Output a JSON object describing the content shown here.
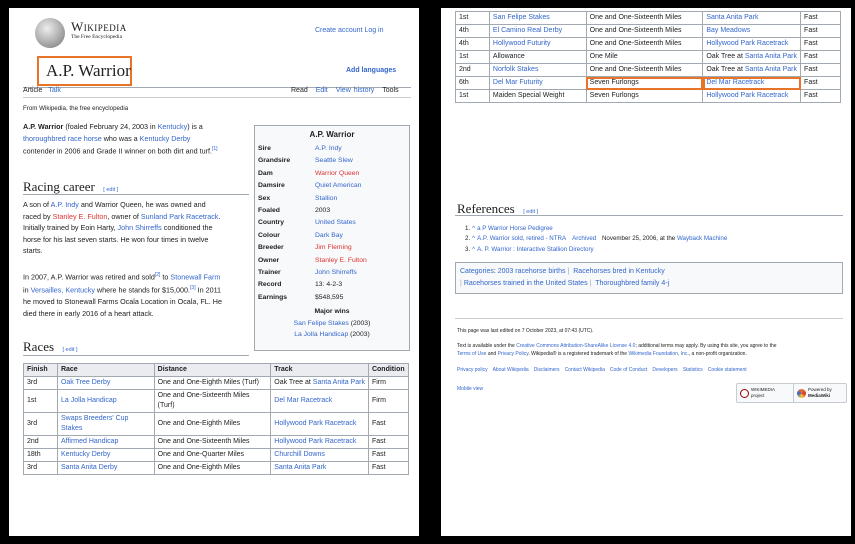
{
  "header": {
    "wordmark": "Wikipedia",
    "tagline": "The Free Encyclopedia",
    "create_account": "Create account",
    "log_in": "Log in",
    "add_languages": "Add languages"
  },
  "title": "A.P. Warrior",
  "tabs": {
    "article": "Article",
    "talk": "Talk",
    "read": "Read",
    "edit": "Edit",
    "view_history": "View history",
    "tools": "Tools"
  },
  "from_wiki": "From Wikipedia, the free encyclopedia",
  "intro": {
    "bold": "A.P. Warrior",
    "t1": " (foaled February 24, 2003 in ",
    "kentucky": "Kentucky",
    "t2": ") is a",
    "thoroughbred": "thoroughbred race horse",
    "t3": " who was a ",
    "kentucky_derby": "Kentucky Derby",
    "t4": "contender in 2006 and Grade II winner on both dirt and turf.",
    "ref": "[1]"
  },
  "sections": {
    "racing_career": "Racing career",
    "races": "Races",
    "references": "References",
    "edit": "[ edit ]"
  },
  "career": {
    "p1_a": "A son of ",
    "ap_indy": "A.P. Indy",
    "p1_b": " and Warrior Queen, he was owned and",
    "p1_c": "raced by ",
    "fulton": "Stanley E. Fulton",
    "p1_d": ", owner of ",
    "sunland": "Sunland Park Racetrack",
    "p1_e": ".",
    "p1_f": "Initially trained by Eoin Harty, ",
    "shirreffs": "John Shirreffs",
    "p1_g": " conditioned the",
    "p1_h": "horse for his last seven starts. He won four times in twelve",
    "p1_i": "starts.",
    "p2_a": "In 2007, A.P. Warrior was retired and sold",
    "ref2": "[2]",
    "p2_b": " to ",
    "stonewall": "Stonewall Farm",
    "p2_c": "in ",
    "versailles": "Versailles, Kentucky",
    "p2_d": " where he stands for $15,000.",
    "ref3": "[3]",
    "p2_e": " In 2011",
    "p2_f": "he moved to Stonewall Farms Ocala Location in Ocala, FL. He",
    "p2_g": "died there in early 2016 of a heart attack."
  },
  "infobox": {
    "title": "A.P. Warrior",
    "rows": [
      {
        "label": "Sire",
        "value": "A.P. Indy",
        "style": "link"
      },
      {
        "label": "Grandsire",
        "value": "Seattle Slew",
        "style": "link"
      },
      {
        "label": "Dam",
        "value": "Warrior Queen",
        "style": "red"
      },
      {
        "label": "Damsire",
        "value": "Quiet American",
        "style": "link"
      },
      {
        "label": "Sex",
        "value": "Stallion",
        "style": "link"
      },
      {
        "label": "Foaled",
        "value": "2003",
        "style": "plain"
      },
      {
        "label": "Country",
        "value": "United States",
        "style": "link"
      },
      {
        "label": "Colour",
        "value": "Dark Bay",
        "style": "link"
      },
      {
        "label": "Breeder",
        "value": "Jim Fleming",
        "style": "red"
      },
      {
        "label": "Owner",
        "value": "Stanley E. Fulton",
        "style": "red"
      },
      {
        "label": "Trainer",
        "value": "John Shirreffs",
        "style": "link"
      },
      {
        "label": "Record",
        "value": "13: 4-2-3",
        "style": "plain"
      },
      {
        "label": "Earnings",
        "value": "$548,595",
        "style": "plain"
      }
    ],
    "major_wins": "Major wins",
    "win1": "San Felipe Stakes",
    "win1_year": " (2003)",
    "win2": "La Jolla Handicap",
    "win2_year": " (2003)"
  },
  "races_table": {
    "headers": [
      "Finish",
      "Race",
      "Distance",
      "Track",
      "Condition"
    ],
    "rows": [
      {
        "finish": "3rd",
        "race": "Oak Tree Derby",
        "distance": "One and One-Eighth Miles (Turf)",
        "track_a": "Oak Tree at ",
        "track_b": "Santa Anita Park",
        "condition": "Firm"
      },
      {
        "finish": "1st",
        "race": "La Jolla Handicap",
        "distance": "One and One-Sixteenth Miles (Turf)",
        "track_a": "",
        "track_b": "Del Mar Racetrack",
        "condition": "Firm"
      },
      {
        "finish": "3rd",
        "race": "Swaps Breeders' Cup Stakes",
        "distance": "One and One-Eighth Miles",
        "track_a": "",
        "track_b": "Hollywood Park Racetrack",
        "condition": "Fast"
      },
      {
        "finish": "2nd",
        "race": "Affirmed Handicap",
        "distance": "One and One-Sixteenth Miles",
        "track_a": "",
        "track_b": "Hollywood Park Racetrack",
        "condition": "Fast"
      },
      {
        "finish": "18th",
        "race": "Kentucky Derby",
        "distance": "One and One-Quarter Miles",
        "track_a": "",
        "track_b": "Churchill Downs",
        "condition": "Fast"
      },
      {
        "finish": "3rd",
        "race": "Santa Anita Derby",
        "distance": "One and One-Eighth Miles",
        "track_a": "",
        "track_b": "Santa Anita Park",
        "condition": "Fast"
      }
    ]
  },
  "races_table_2": {
    "rows": [
      {
        "finish": "1st",
        "race": "San Felipe Stakes",
        "race_link": true,
        "distance": "One and One-Sixteenth Miles",
        "track_a": "",
        "track_b": "Santa Anita Park",
        "condition": "Fast"
      },
      {
        "finish": "4th",
        "race": "El Camino Real Derby",
        "race_link": true,
        "distance": "One and One-Sixteenth Miles",
        "track_a": "",
        "track_b": "Bay Meadows",
        "condition": "Fast"
      },
      {
        "finish": "4th",
        "race": "Hollywood Futurity",
        "race_link": true,
        "distance": "One and One-Sixteenth Miles",
        "track_a": "",
        "track_b": "Hollywood Park Racetrack",
        "condition": "Fast"
      },
      {
        "finish": "1st",
        "race": "Allowance",
        "race_link": false,
        "distance": "One Mile",
        "track_a": "Oak Tree at ",
        "track_b": "Santa Anita Park",
        "condition": "Fast"
      },
      {
        "finish": "2nd",
        "race": "Norfolk Stakes",
        "race_link": true,
        "distance": "One and One-Sixteenth Miles",
        "track_a": "Oak Tree at ",
        "track_b": "Santa Anita Park",
        "condition": "Fast"
      },
      {
        "finish": "6th",
        "race": "Del Mar Futurity",
        "race_link": true,
        "distance": "Seven Furlongs",
        "track_a": "",
        "track_b": "Del Mar Racetrack",
        "condition": "Fast",
        "highlight": true
      },
      {
        "finish": "1st",
        "race": "Maiden Special Weight",
        "race_link": false,
        "distance": "Seven Furlongs",
        "track_a": "",
        "track_b": "Hollywood Park Racetrack",
        "condition": "Fast"
      }
    ]
  },
  "references": [
    {
      "n": "1.",
      "caret": "^",
      "a": "a P Warrior Horse Pedigree",
      "b": "",
      "c": ""
    },
    {
      "n": "2.",
      "caret": "^",
      "a": "A.P. Warrior sold, retired - NTRA",
      "b": "Archived",
      "c": " November 25, 2006, at the ",
      "d": "Wayback Machine"
    },
    {
      "n": "3.",
      "caret": "^",
      "a": "A. P. Warrior : Interactive Stallion Directory",
      "b": "",
      "c": ""
    }
  ],
  "categories": {
    "label": "Categories",
    "items": [
      "2003 racehorse births",
      "Racehorses bred in Kentucky",
      "Racehorses trained in the United States",
      "Thoroughbred family 4-j"
    ]
  },
  "footer": {
    "last_edited": "This page was last edited on 7 October 2023, at 07:43 (UTC).",
    "license_a": "Text is available under the ",
    "license_link": "Creative Commons Attribution-ShareAlike License 4.0",
    "license_b": "; additional terms may apply. By using this site, you agree to the",
    "terms": "Terms of Use",
    "and": " and ",
    "privacy": "Privacy Policy",
    "license_c": ". Wikipedia® is a registered trademark of the ",
    "foundation": "Wikimedia Foundation, Inc.",
    "license_d": ", a non-profit organization.",
    "links": [
      "Privacy policy",
      "About Wikipedia",
      "Disclaimers",
      "Contact Wikipedia",
      "Code of Conduct",
      "Developers",
      "Statistics",
      "Cookie statement"
    ],
    "mobile_view": "Mobile view",
    "badge1_a": "WIKIMEDIA",
    "badge1_b": "project",
    "badge2_a": "Powered by",
    "badge2_b": "MediaWiki"
  }
}
